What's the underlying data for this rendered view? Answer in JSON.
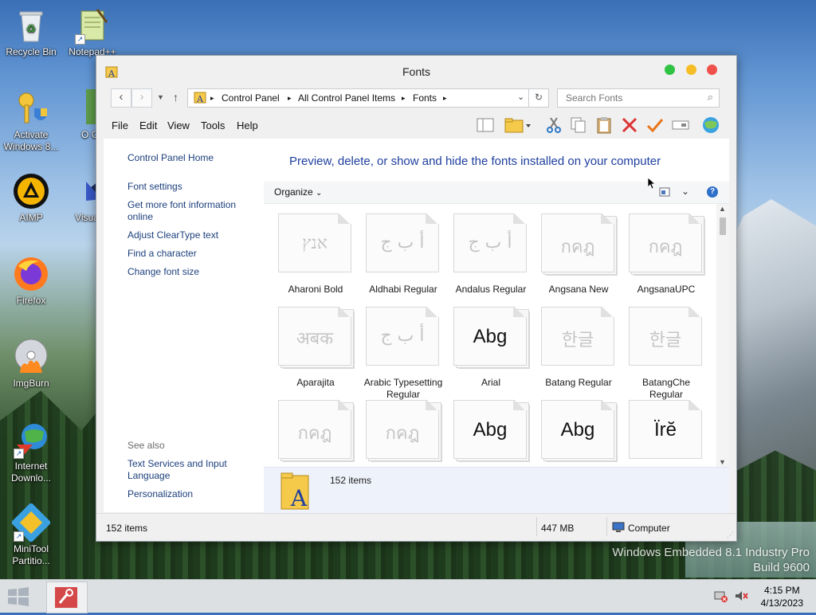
{
  "desktop": {
    "icons": [
      {
        "label": "Recycle Bin"
      },
      {
        "label": "Notepad++"
      },
      {
        "label": "Activate Windows 8..."
      },
      {
        "label": "O Ca"
      },
      {
        "label": "AIMP"
      },
      {
        "label": "Visual S"
      },
      {
        "label": "Firefox"
      },
      {
        "label": "ImgBurn"
      },
      {
        "label": "Internet Downlo..."
      },
      {
        "label": "MiniTool Partitio..."
      }
    ],
    "watermark_line1": "Windows Embedded 8.1 Industry Pro",
    "watermark_line2": "Build 9600"
  },
  "taskbar": {
    "time": "4:15 PM",
    "date": "4/13/2023"
  },
  "window": {
    "title": "Fonts",
    "controls_colors": {
      "close": "#f0504a",
      "minimize": "#f5bd26",
      "maximize": "#2fc243"
    },
    "breadcrumb": [
      "Control Panel",
      "All Control Panel Items",
      "Fonts"
    ],
    "search_placeholder": "Search Fonts",
    "menu": [
      "File",
      "Edit",
      "View",
      "Tools",
      "Help"
    ],
    "left_pane": {
      "home": "Control Panel Home",
      "links": [
        "Font settings",
        "Get more font information online",
        "Adjust ClearType text",
        "Find a character",
        "Change font size"
      ],
      "see_also_title": "See also",
      "see_also": [
        "Text Services and Input Language",
        "Personalization"
      ]
    },
    "heading": "Preview, delete, or show and hide the fonts installed on your computer",
    "organize_label": "Organize",
    "fonts": [
      {
        "name": "Aharoni Bold",
        "sample": "אנץ",
        "stack": false,
        "dark": false
      },
      {
        "name": "Aldhabi Regular",
        "sample": "أ ب ج",
        "stack": false,
        "dark": false
      },
      {
        "name": "Andalus Regular",
        "sample": "أ ب ج",
        "stack": false,
        "dark": false
      },
      {
        "name": "Angsana New",
        "sample": "กคฎ",
        "stack": true,
        "dark": false
      },
      {
        "name": "AngsanaUPC",
        "sample": "กคฎ",
        "stack": true,
        "dark": false
      },
      {
        "name": "Aparajita",
        "sample": "अबक",
        "stack": true,
        "dark": false
      },
      {
        "name": "Arabic Typesetting Regular",
        "sample": "أ ب ج",
        "stack": false,
        "dark": false
      },
      {
        "name": "Arial",
        "sample": "Abg",
        "stack": true,
        "dark": true
      },
      {
        "name": "Batang Regular",
        "sample": "한글",
        "stack": false,
        "dark": false
      },
      {
        "name": "BatangChe Regular",
        "sample": "한글",
        "stack": false,
        "dark": false
      },
      {
        "name": "",
        "sample": "กคฎ",
        "stack": true,
        "dark": false
      },
      {
        "name": "",
        "sample": "กคฎ",
        "stack": true,
        "dark": false
      },
      {
        "name": "",
        "sample": "Abg",
        "stack": true,
        "dark": true
      },
      {
        "name": "",
        "sample": "Abg",
        "stack": true,
        "dark": true
      },
      {
        "name": "",
        "sample": "Ïrĕ",
        "stack": false,
        "dark": true
      }
    ],
    "details_count": "152 items",
    "status": {
      "items": "152 items",
      "size": "447 MB",
      "location": "Computer"
    }
  }
}
